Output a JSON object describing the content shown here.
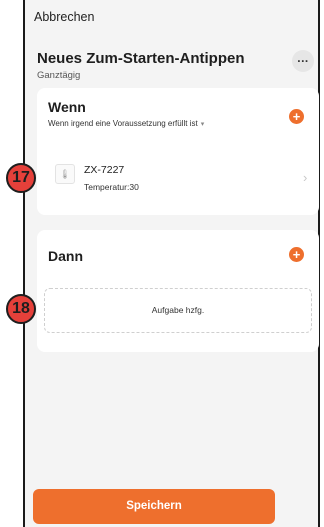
{
  "header": {
    "cancel_label": "Abbrechen",
    "title": "Neues Zum-Starten-Antippen",
    "subtitle": "Ganztägig",
    "more_label": "..."
  },
  "when": {
    "title": "Wenn",
    "subtitle": "Wenn irgend eine Voraussetzung erfüllt ist",
    "caret": "▾",
    "add_label": "+",
    "condition": {
      "device_icon": "thermometer-icon",
      "icon_glyph": "🌡",
      "device_name": "ZX-7227",
      "detail": "Temperatur:30",
      "chevron": "›"
    }
  },
  "then": {
    "title": "Dann",
    "add_label": "+",
    "task_placeholder": "Aufgabe hzfg."
  },
  "footer": {
    "save_label": "Speichern"
  },
  "annotations": {
    "callout_17": "17",
    "callout_18": "18"
  },
  "colors": {
    "accent": "#ee6f2d",
    "callout": "#e5403a",
    "background": "#f4f4f4",
    "card": "#ffffff"
  }
}
